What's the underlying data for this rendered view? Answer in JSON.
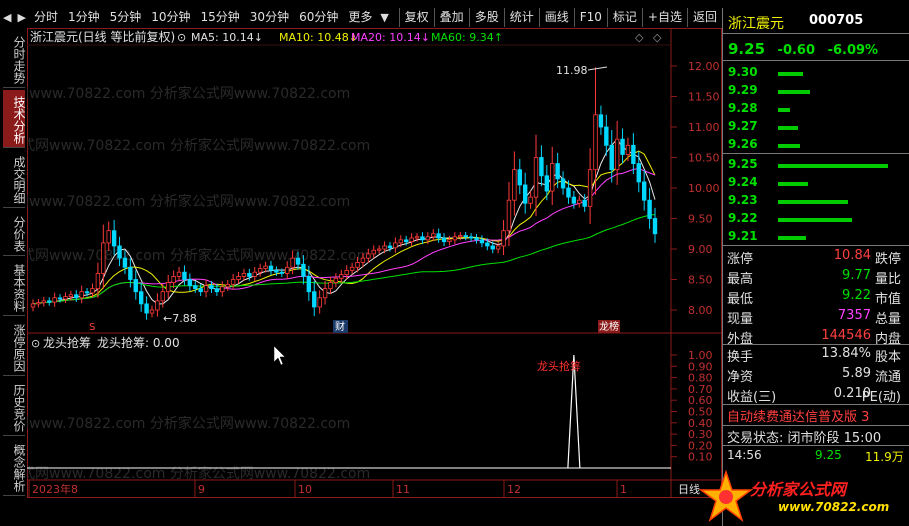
{
  "toolbar": {
    "periods": [
      "分时",
      "1分钟",
      "5分钟",
      "10分钟",
      "15分钟",
      "30分钟",
      "60分钟",
      "更多"
    ],
    "actions": [
      "复权",
      "叠加",
      "多股",
      "统计",
      "画线",
      "F10",
      "标记",
      "+自选",
      "返回"
    ]
  },
  "left_tabs": [
    "分时走势",
    "技术分析",
    "成交明细",
    "分价表",
    "基本资料",
    "涨停原因",
    "历史竞价",
    "概念解析"
  ],
  "chart_header": {
    "title": "浙江震元(日线 等比前复权)",
    "ma5": "MA5: 10.14↓",
    "ma10": "MA10: 10.48↓",
    "ma20": "MA20: 10.14↓",
    "ma60": "MA60: 9.34↑"
  },
  "indicator_header": {
    "name": "龙头抢筹",
    "value": "龙头抢筹: 0.00",
    "signal_label": "龙头抢筹"
  },
  "price_axis": [
    "12.00",
    "11.50",
    "11.00",
    "10.50",
    "10.00",
    "9.50",
    "9.00",
    "8.50",
    "8.00"
  ],
  "indicator_axis": [
    "1.00",
    "0.90",
    "0.80",
    "0.70",
    "0.60",
    "0.50",
    "0.40",
    "0.30",
    "0.20",
    "0.10"
  ],
  "date_axis": [
    "2023年8",
    "9",
    "10",
    "11",
    "12",
    "1"
  ],
  "date_axis_end": "日线",
  "annotations": {
    "high": "11.98",
    "low": "←7.88",
    "marker_s": "S",
    "marker_cai": "财",
    "marker_bang": "龙榜"
  },
  "watermark": "公式网www.70822.com 分析家公式网www.70822.com",
  "chart_data": {
    "type": "candlestick",
    "title": "浙江震元(日线 等比前复权)",
    "ylim": [
      7.8,
      12.3
    ],
    "closes": [
      8.1,
      8.12,
      8.15,
      8.13,
      8.2,
      8.18,
      8.22,
      8.25,
      8.2,
      8.3,
      8.28,
      8.35,
      8.6,
      9.1,
      9.3,
      9.05,
      8.85,
      8.7,
      8.5,
      8.3,
      8.1,
      7.95,
      8.0,
      8.15,
      8.3,
      8.45,
      8.55,
      8.62,
      8.5,
      8.4,
      8.35,
      8.3,
      8.4,
      8.35,
      8.3,
      8.38,
      8.42,
      8.5,
      8.55,
      8.6,
      8.55,
      8.62,
      8.68,
      8.72,
      8.65,
      8.62,
      8.6,
      8.7,
      8.85,
      8.75,
      8.55,
      8.3,
      8.05,
      8.2,
      8.35,
      8.45,
      8.52,
      8.58,
      8.65,
      8.7,
      8.78,
      8.85,
      8.92,
      8.98,
      9.0,
      9.05,
      9.02,
      9.1,
      9.15,
      9.12,
      9.18,
      9.2,
      9.15,
      9.2,
      9.25,
      9.18,
      9.12,
      9.15,
      9.2,
      9.22,
      9.2,
      9.18,
      9.15,
      9.1,
      9.05,
      9.0,
      9.05,
      9.3,
      9.8,
      10.3,
      10.05,
      9.75,
      9.85,
      10.5,
      10.2,
      9.95,
      10.4,
      10.15,
      10.0,
      9.85,
      9.75,
      9.8,
      9.7,
      10.3,
      11.2,
      11.0,
      10.7,
      10.3,
      10.8,
      10.55,
      10.7,
      10.4,
      10.1,
      9.8,
      9.5,
      9.25
    ],
    "ma_current": {
      "MA5": 10.14,
      "MA10": 10.48,
      "MA20": 10.14,
      "MA60": 9.34
    },
    "high": 11.98,
    "low": 7.88,
    "indicator_signal_index": 100,
    "indicator_signal_value": 1.0
  },
  "panel": {
    "name": "浙江震元",
    "code": "000705",
    "price": "9.25",
    "change": "-0.60",
    "change_pct": "-6.09%",
    "asks": [
      {
        "price": "9.30",
        "bar": 25
      },
      {
        "price": "9.29",
        "bar": 32
      },
      {
        "price": "9.28",
        "bar": 12
      },
      {
        "price": "9.27",
        "bar": 20
      },
      {
        "price": "9.26",
        "bar": 22
      }
    ],
    "bids": [
      {
        "price": "9.25",
        "bar": 110
      },
      {
        "price": "9.24",
        "bar": 30
      },
      {
        "price": "9.23",
        "bar": 70
      },
      {
        "price": "9.22",
        "bar": 74
      },
      {
        "price": "9.21",
        "bar": 28
      }
    ],
    "stats1": [
      {
        "l": "涨停",
        "v": "10.84",
        "r": "跌停",
        "c": "#ff4040"
      },
      {
        "l": "最高",
        "v": "9.77",
        "r": "量比",
        "c": "#00e000"
      },
      {
        "l": "最低",
        "v": "9.22",
        "r": "市值",
        "c": "#00e000"
      },
      {
        "l": "现量",
        "v": "7357",
        "r": "总量",
        "c": "#ff40ff"
      },
      {
        "l": "外盘",
        "v": "144546",
        "r": "内盘",
        "c": "#ff4040"
      }
    ],
    "stats2": [
      {
        "l": "换手",
        "v": "13.84%",
        "r": "股本",
        "c": "#e0e0e0"
      },
      {
        "l": "净资",
        "v": "5.89",
        "r": "流通",
        "c": "#e0e0e0"
      },
      {
        "l": "收益(三)",
        "v": "0.210",
        "r": "PE(动)",
        "c": "#e0e0e0"
      }
    ],
    "ticker": "自动续费通达信普及版 3",
    "trade_status": "交易状态: 闭市阶段 15:00",
    "tick_time": "14:56",
    "tick_price": "9.25",
    "tick_vol": "11.9万"
  },
  "logo": {
    "name": "分析家公式网",
    "url": "www.70822.com"
  }
}
